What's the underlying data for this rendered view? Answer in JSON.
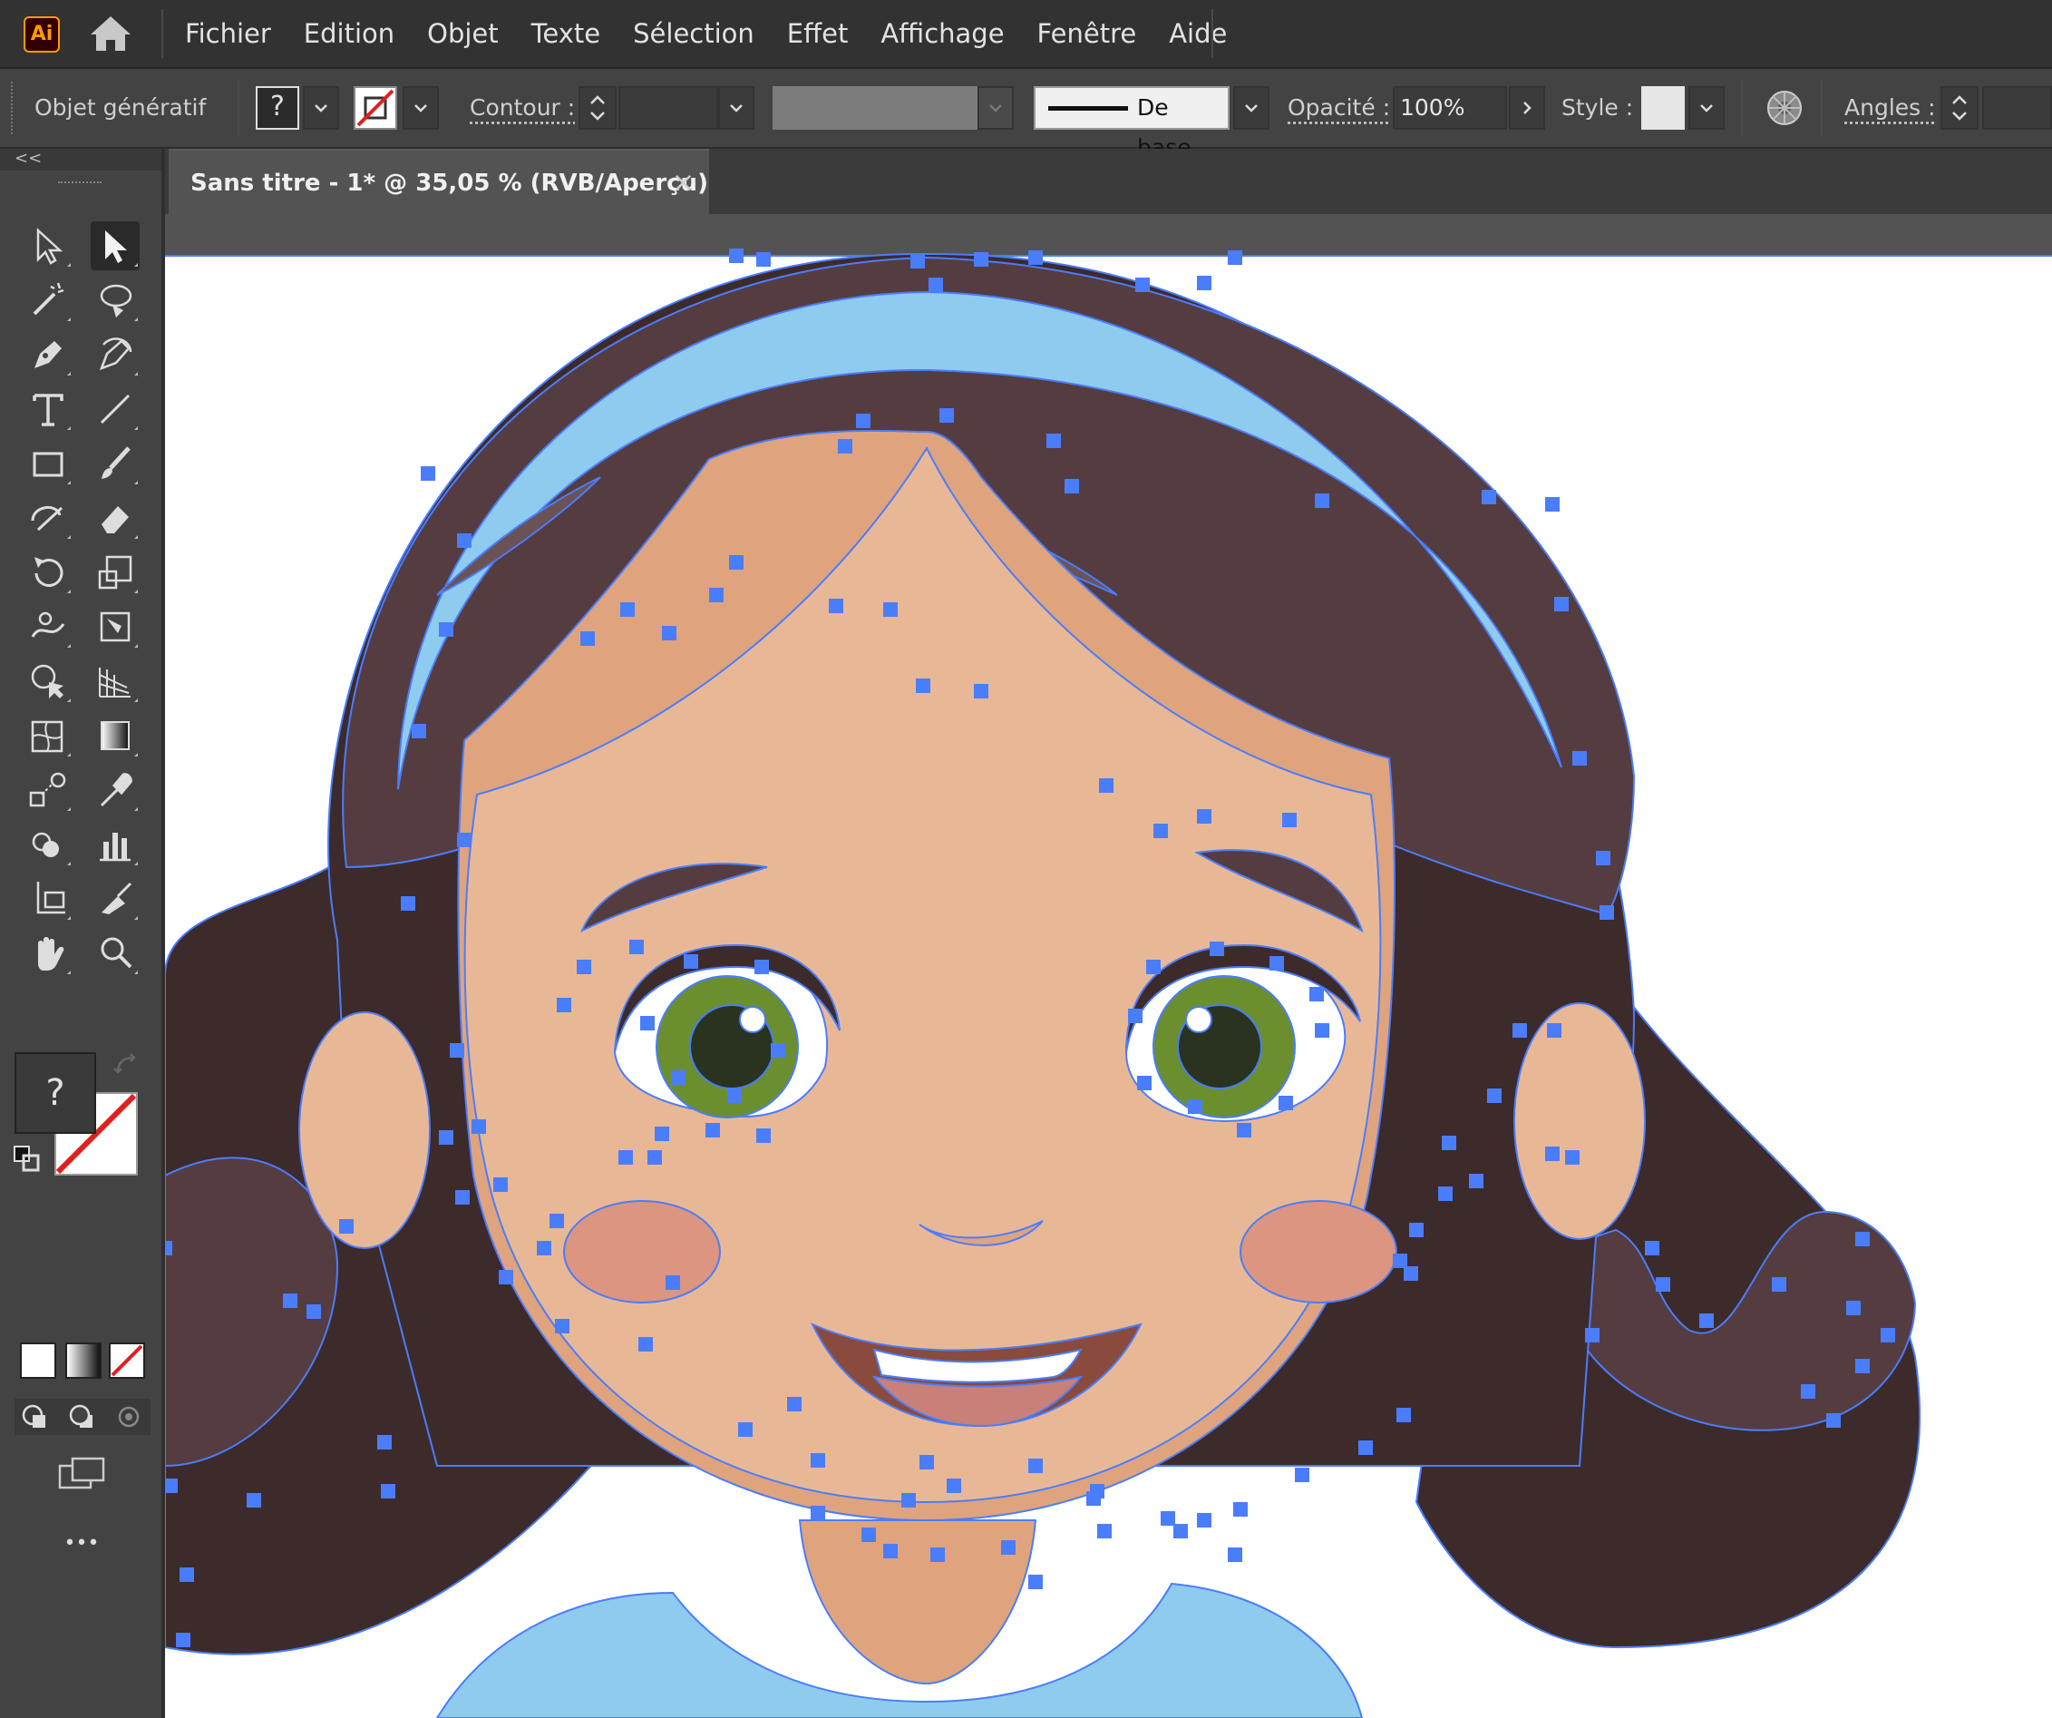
{
  "app": {
    "logo_text": "Ai"
  },
  "menu": [
    "Fichier",
    "Edition",
    "Objet",
    "Texte",
    "Sélection",
    "Effet",
    "Affichage",
    "Fenêtre",
    "Aide"
  ],
  "control_bar": {
    "object_type": "Objet génératif",
    "fill_unknown": "?",
    "stroke_label": "Contour :",
    "brush_value": "De base",
    "opacity_label": "Opacité :",
    "opacity_value": "100%",
    "style_label": "Style :",
    "corners_label": "Angles :"
  },
  "toolbar": {
    "collapse": "<<",
    "fill_unknown": "?",
    "more": "•••",
    "tools": [
      "selection-tool",
      "direct-selection-tool",
      "magic-wand-tool",
      "lasso-tool",
      "pen-tool",
      "curvature-tool",
      "type-tool",
      "line-tool",
      "rectangle-tool",
      "paintbrush-tool",
      "shaper-tool",
      "eraser-tool",
      "rotate-tool",
      "scale-tool",
      "warp-tool",
      "free-transform-tool",
      "shape-builder-tool",
      "perspective-grid-tool",
      "mesh-tool",
      "gradient-tool",
      "blend-tool",
      "eyedropper-tool",
      "symbol-sprayer-tool",
      "column-graph-tool",
      "artboard-tool",
      "slice-tool",
      "hand-tool",
      "zoom-tool"
    ]
  },
  "document": {
    "tab_title": "Sans titre - 1* @ 35,05 % (RVB/Aperçu)",
    "close": "×"
  },
  "colors": {
    "hair_dark": "#3d2a2b",
    "hair": "#553c40",
    "hair_light": "#6a5256",
    "skin": "#e8b896",
    "skin_shadow": "#dfa47d",
    "headband": "#8ecbef",
    "eye_green": "#6b8f2e",
    "pupil": "#2a3320",
    "cheek": "#db9580",
    "mouth": "#8a4a3d",
    "tongue": "#c98078",
    "anchor": "#4a7dfc",
    "accent": "#ff9a00"
  }
}
